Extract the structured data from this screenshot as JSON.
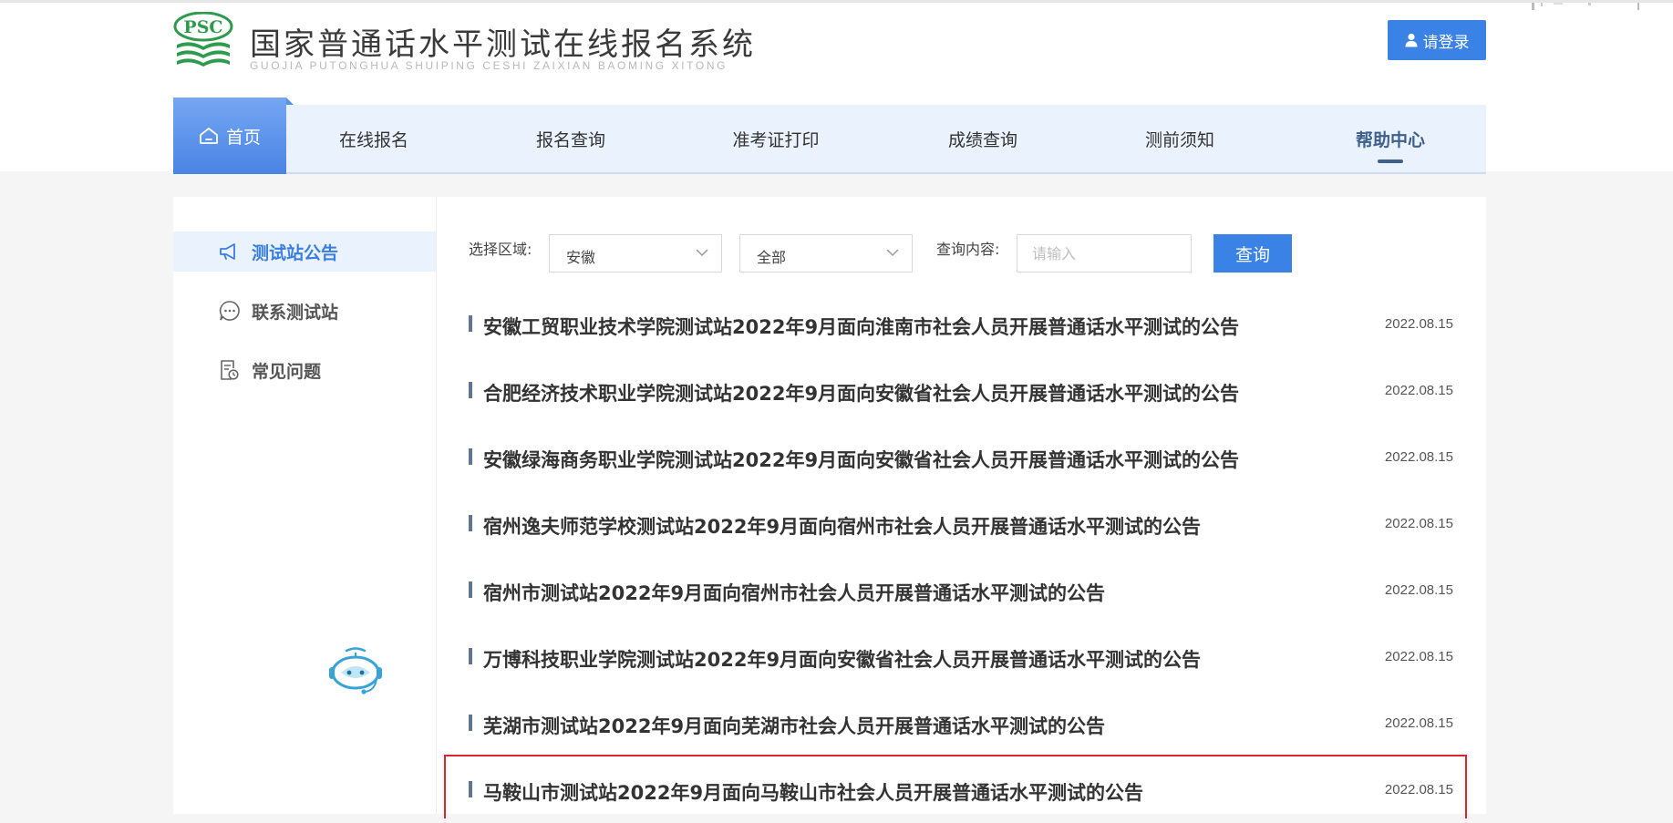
{
  "header": {
    "logo_badge": "PSC",
    "title": "国家普通话水平测试在线报名系统",
    "subtitle": "GUOJIA PUTONGHUA SHUIPING CESHI ZAIXIAN BAOMING XITONG",
    "login_label": "请登录"
  },
  "nav": {
    "home": "首页",
    "items": [
      "在线报名",
      "报名查询",
      "准考证打印",
      "成绩查询",
      "测前须知",
      "帮助中心"
    ],
    "active": "帮助中心"
  },
  "sidebar": {
    "items": [
      "测试站公告",
      "联系测试站",
      "常见问题"
    ],
    "active": "测试站公告"
  },
  "filters": {
    "region_label": "选择区域:",
    "province": "安徽",
    "city": "全部",
    "query_label": "查询内容:",
    "query_placeholder": "请输入",
    "query_button": "查询"
  },
  "announcements": [
    {
      "title": "安徽工贸职业技术学院测试站2022年9月面向淮南市社会人员开展普通话水平测试的公告",
      "date": "2022.08.15"
    },
    {
      "title": "合肥经济技术职业学院测试站2022年9月面向安徽省社会人员开展普通话水平测试的公告",
      "date": "2022.08.15"
    },
    {
      "title": "安徽绿海商务职业学院测试站2022年9月面向安徽省社会人员开展普通话水平测试的公告",
      "date": "2022.08.15"
    },
    {
      "title": "宿州逸夫师范学校测试站2022年9月面向宿州市社会人员开展普通话水平测试的公告",
      "date": "2022.08.15"
    },
    {
      "title": "宿州市测试站2022年9月面向宿州市社会人员开展普通话水平测试的公告",
      "date": "2022.08.15"
    },
    {
      "title": "万博科技职业学院测试站2022年9月面向安徽省社会人员开展普通话水平测试的公告",
      "date": "2022.08.15"
    },
    {
      "title": "芜湖市测试站2022年9月面向芜湖市社会人员开展普通话水平测试的公告",
      "date": "2022.08.15"
    },
    {
      "title": "马鞍山市测试站2022年9月面向马鞍山市社会人员开展普通话水平测试的公告",
      "date": "2022.08.15"
    }
  ],
  "colors": {
    "accent": "#3b82e6",
    "highlight_box": "#d8252f",
    "logo_green": "#2e9b4c"
  }
}
